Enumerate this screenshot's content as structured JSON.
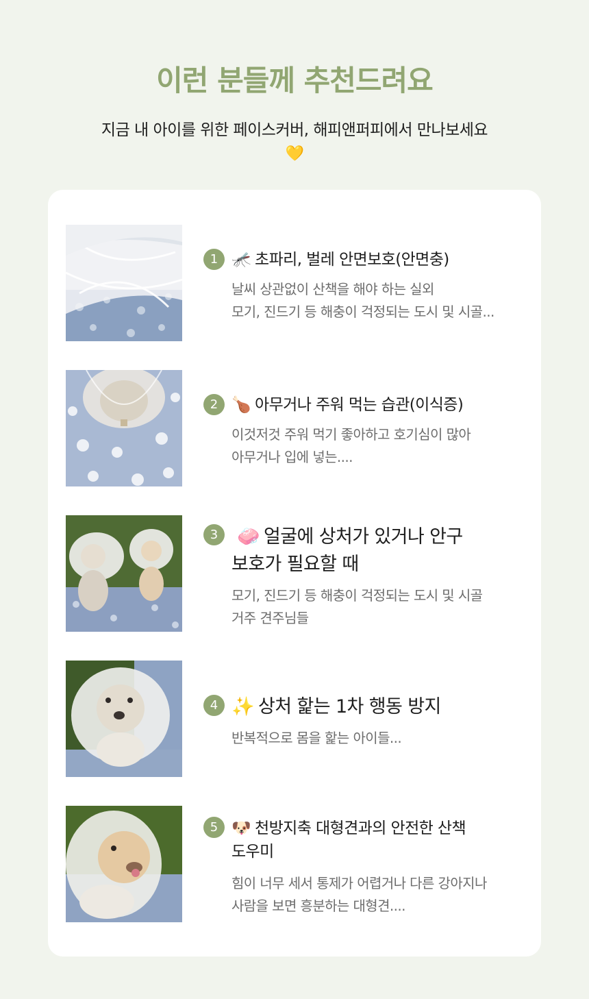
{
  "header": {
    "headline": "이런 분들께 추천드려요",
    "subline": "지금 내 아이를 위한 페이스커버,  해피앤퍼피에서 만나보세요",
    "heart_emoji": "💛"
  },
  "colors": {
    "background": "#f1f4ed",
    "accent_green": "#91a672",
    "card": "#ffffff",
    "title_text": "#1e1e1e",
    "desc_text": "#6d6d6d"
  },
  "items": [
    {
      "number": "1",
      "emoji": "🦟",
      "title": "초파리, 벌레  안면보호(안면충)",
      "desc_line1": "날씨 상관없이 산책을 해야 하는 실외",
      "desc_line2": "모기, 진드기 등 해충이 걱정되는 도시 및 시골...",
      "image": "tulle-net-closeup"
    },
    {
      "number": "2",
      "emoji": "🍗",
      "title": "아무거나 주워 먹는 습관(이식증)",
      "desc_line1": "이것저것 주워 먹기 좋아하고 호기심이 많아",
      "desc_line2": "아무거나 입에 넣는....",
      "image": "dog-head-under-cover"
    },
    {
      "number": "3",
      "emoji": "🧼",
      "title_line1": "얼굴에 상처가 있거나 안구",
      "title_line2": "보호가 필요할 때",
      "desc_line1": "모기, 진드기 등 해충이 걱정되는 도시 및 시골",
      "desc_line2": "거주 견주님들",
      "image": "two-dogs-wearing-covers"
    },
    {
      "number": "4",
      "emoji": "✨",
      "title": "상처 핥는 1차 행동 방지",
      "desc_line1": "반복적으로 몸을 핥는 아이들...",
      "image": "dog-face-in-veil"
    },
    {
      "number": "5",
      "emoji": "🐶",
      "title_line1": "천방지축 대형견과의 안전한 산책",
      "title_line2": "도우미",
      "desc_line1": "힘이 너무 세서 통제가 어렵거나 다른 강아지나",
      "desc_line2": "사람을 보면 흥분하는 대형견....",
      "image": "dog-sticking-tongue-out"
    }
  ]
}
